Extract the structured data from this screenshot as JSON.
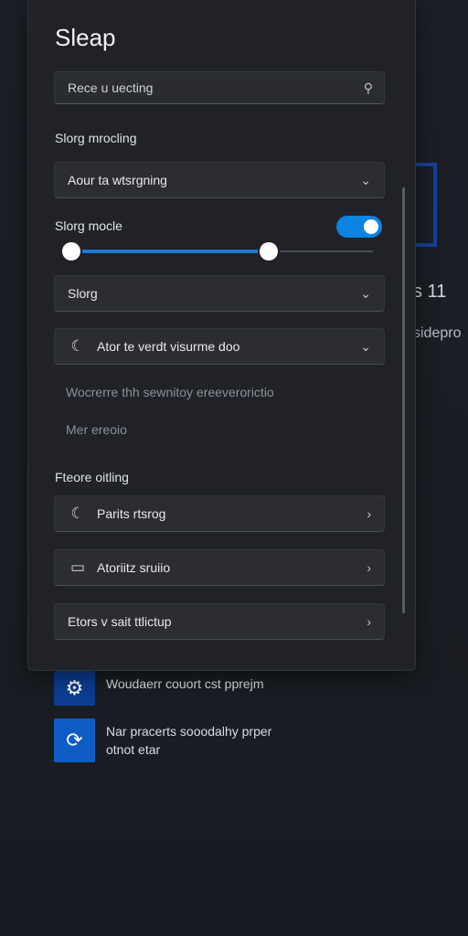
{
  "background": {
    "heading_fragment": "s 11",
    "subtext_fragment": "sidepro",
    "items": [
      {
        "icon": "settings-app-icon",
        "text_lines": [
          "Woudaerr couort cst pprejm"
        ]
      },
      {
        "icon": "refresh-app-icon",
        "text_lines": [
          "Nar pracerts sooodalhy prper",
          "otnot etar"
        ]
      }
    ]
  },
  "panel": {
    "title": "Sleap",
    "search": {
      "placeholder": "Rece u uecting",
      "icon": "search-icon"
    },
    "section1": "Slorg mrocling",
    "dropdown1": {
      "label": "Aour ta wtsrgning",
      "icon": "chevron-down-icon"
    },
    "toggle": {
      "label": "Slorg mocle",
      "state": "on"
    },
    "slider": {
      "min_value": 0,
      "max_value": 0.65
    },
    "dropdown2": {
      "label": "Slorg",
      "icon": "chevron-down-icon"
    },
    "dropdown3": {
      "label": "Ator te verdt visurme doo",
      "lead_icon": "moon-icon",
      "icon": "chevron-down-icon"
    },
    "desc1": "Wocrerre thh sewnitoy ereeverorictio",
    "desc2": "Mer ereoio",
    "section2": "Fteore oitling",
    "nav": [
      {
        "label": "Parits rtsrog",
        "lead_icon": "moon-icon",
        "icon": "chevron-right-icon"
      },
      {
        "label": "Atoriitz sruiio",
        "lead_icon": "display-icon",
        "icon": "chevron-right-icon"
      },
      {
        "label": "Etors v sait ttlictup",
        "icon": "chevron-right-icon"
      }
    ]
  },
  "colors": {
    "accent": "#0a84e0",
    "panel_bg": "#202227",
    "page_bg": "#1a1d24"
  }
}
